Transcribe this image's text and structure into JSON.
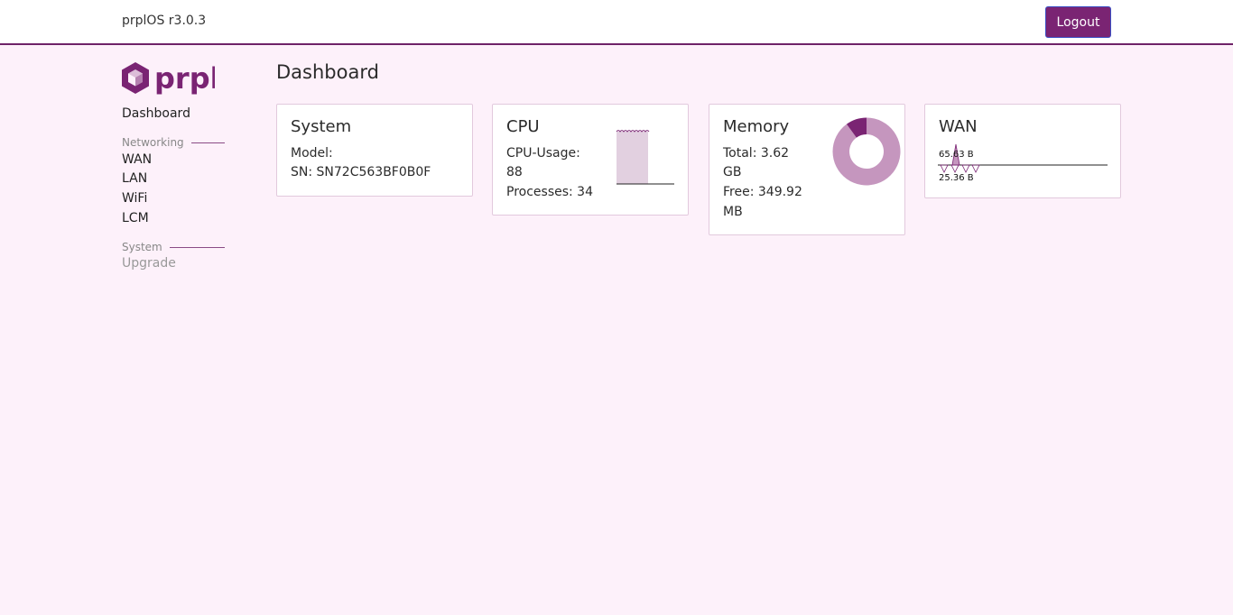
{
  "header": {
    "version": "prplOS r3.0.3",
    "logout_label": "Logout"
  },
  "logo": {
    "text": "prpl",
    "icon": "prpl-cube-logo"
  },
  "sidebar": {
    "dashboard": "Dashboard",
    "sections": [
      {
        "title": "Networking",
        "items": [
          "WAN",
          "LAN",
          "WiFi",
          "LCM"
        ]
      },
      {
        "title": "System",
        "items": [
          "Upgrade"
        ]
      }
    ]
  },
  "main": {
    "title": "Dashboard",
    "cards": {
      "system": {
        "title": "System",
        "model": "Model:",
        "sn": "SN: SN72C563BF0B0F"
      },
      "cpu": {
        "title": "CPU",
        "usage_label": "CPU-Usage:",
        "usage_value": "88",
        "processes": "Processes: 34",
        "usage_percent": 88
      },
      "memory": {
        "title": "Memory",
        "total_a": "Total: 3.62",
        "total_b": "GB",
        "free_a": "Free: 349.92",
        "free_b": "MB",
        "used_fraction": 0.9
      },
      "wan": {
        "title": "WAN",
        "rx_label": "65.63 B",
        "tx_label": "25.36 B"
      }
    }
  },
  "colors": {
    "accent": "#7a2473",
    "background": "#fdf1fa",
    "chart_light": "#c596be",
    "cpu_fill": "#e2d0e0"
  }
}
